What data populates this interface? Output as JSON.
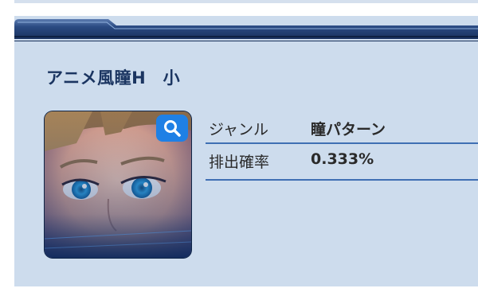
{
  "item": {
    "title": "アニメ風瞳H　小",
    "thumbnail_icon": "anime-eye-portrait",
    "zoom_icon": "magnifier-icon"
  },
  "details": [
    {
      "label": "ジャンル",
      "value": "瞳パターン"
    },
    {
      "label": "排出確率",
      "value": "0.333%"
    }
  ],
  "colors": {
    "panel_bg": "#cddced",
    "header_bar": "#1f3a68",
    "title_text": "#1b3561",
    "row_divider": "#3f6fb3",
    "zoom_button": "#1f80e5"
  }
}
